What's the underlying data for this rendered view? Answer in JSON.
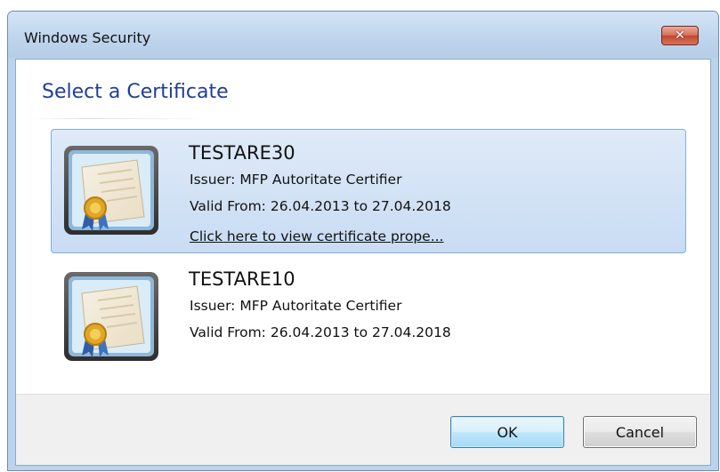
{
  "window": {
    "title": "Windows Security",
    "close_glyph": "✕"
  },
  "dialog": {
    "heading": "Select a Certificate"
  },
  "certificates": [
    {
      "name": "TESTARE30",
      "issuer": "Issuer: MFP Autoritate Certifier",
      "valid": "Valid From: 26.04.2013 to 27.04.2018",
      "link": "Click here to view certificate prope...",
      "selected": true,
      "icon": "certificate-icon"
    },
    {
      "name": "TESTARE10",
      "issuer": "Issuer: MFP Autoritate Certifier",
      "valid": "Valid From: 26.04.2013 to 27.04.2018",
      "selected": false,
      "icon": "certificate-icon"
    }
  ],
  "buttons": {
    "ok": "OK",
    "cancel": "Cancel"
  },
  "colors": {
    "heading": "#1f3d9a",
    "selection": "#c8dcf3",
    "close": "#c3462f"
  }
}
